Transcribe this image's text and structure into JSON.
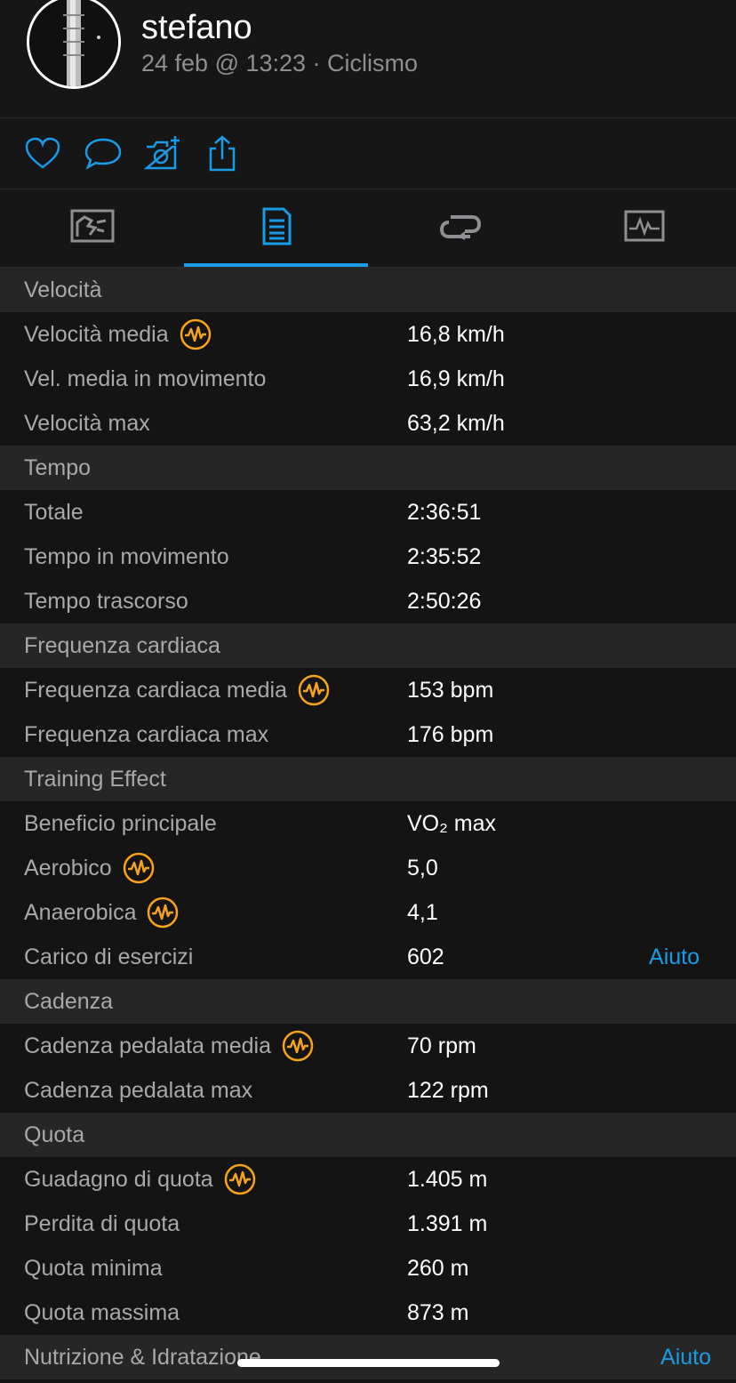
{
  "header": {
    "user_name": "stefano",
    "meta": "24 feb @ 13:23 · Ciclismo"
  },
  "actions": [
    "heart-icon",
    "comment-icon",
    "add-photo-icon",
    "share-icon"
  ],
  "tabs": [
    {
      "icon": "chart-map-icon",
      "active": false
    },
    {
      "icon": "stats-document-icon",
      "active": true
    },
    {
      "icon": "laps-icon",
      "active": false
    },
    {
      "icon": "graph-icon",
      "active": false
    }
  ],
  "accent_color": "#1a9be6",
  "badge_color": "#f7a21b",
  "sections": {
    "velocita": {
      "title": "Velocità",
      "rows": [
        {
          "label": "Velocità media",
          "value": "16,8 km/h"
        },
        {
          "label": "Vel. media in movimento",
          "value": "16,9 km/h"
        },
        {
          "label": "Velocità max",
          "value": "63,2 km/h"
        }
      ]
    },
    "tempo": {
      "title": "Tempo",
      "rows": [
        {
          "label": "Totale",
          "value": "2:36:51"
        },
        {
          "label": "Tempo in movimento",
          "value": "2:35:52"
        },
        {
          "label": "Tempo trascorso",
          "value": "2:50:26"
        }
      ]
    },
    "frequenza": {
      "title": "Frequenza cardiaca",
      "rows": [
        {
          "label": "Frequenza cardiaca media",
          "value": "153 bpm"
        },
        {
          "label": "Frequenza cardiaca max",
          "value": "176 bpm"
        }
      ]
    },
    "training": {
      "title": "Training Effect",
      "rows": [
        {
          "label": "Beneficio principale",
          "value": "VO₂ max"
        },
        {
          "label": "Aerobico",
          "value": "5,0"
        },
        {
          "label": "Anaerobica",
          "value": "4,1"
        },
        {
          "label": "Carico di esercizi",
          "value": "602",
          "link": "Aiuto"
        }
      ]
    },
    "cadenza": {
      "title": "Cadenza",
      "rows": [
        {
          "label": "Cadenza pedalata media",
          "value": "70 rpm"
        },
        {
          "label": "Cadenza pedalata max",
          "value": "122 rpm"
        }
      ]
    },
    "quota": {
      "title": "Quota",
      "rows": [
        {
          "label": "Guadagno di quota",
          "value": "1.405 m"
        },
        {
          "label": "Perdita di quota",
          "value": "1.391 m"
        },
        {
          "label": "Quota minima",
          "value": "260 m"
        },
        {
          "label": "Quota massima",
          "value": "873 m"
        }
      ]
    },
    "nutrizione": {
      "title": "Nutrizione & Idratazione",
      "link": "Aiuto"
    }
  }
}
